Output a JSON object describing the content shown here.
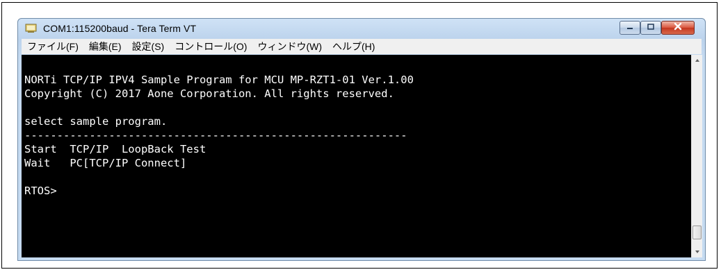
{
  "window": {
    "title": "COM1:115200baud - Tera Term VT",
    "icon": "tera-term-icon",
    "controls": {
      "minimize": "minimize-icon",
      "maximize": "maximize-icon",
      "close": "close-icon"
    }
  },
  "menu": {
    "items": [
      {
        "label": "ファイル(F)"
      },
      {
        "label": "編集(E)"
      },
      {
        "label": "設定(S)"
      },
      {
        "label": "コントロール(O)"
      },
      {
        "label": "ウィンドウ(W)"
      },
      {
        "label": "ヘルプ(H)"
      }
    ]
  },
  "terminal": {
    "lines": [
      "NORTi TCP/IP IPV4 Sample Program for MCU MP-RZT1-01 Ver.1.00",
      "Copyright (C) 2017 Aone Corporation. All rights reserved.",
      "select sample program.",
      "-----------------------------------------------------------",
      "Start  TCP/IP  LoopBack Test",
      "Wait   PC[TCP/IP Connect]",
      "RTOS>"
    ]
  },
  "colors": {
    "terminal_bg": "#000000",
    "terminal_fg": "#ffffff",
    "close_button": "#c4371f"
  }
}
